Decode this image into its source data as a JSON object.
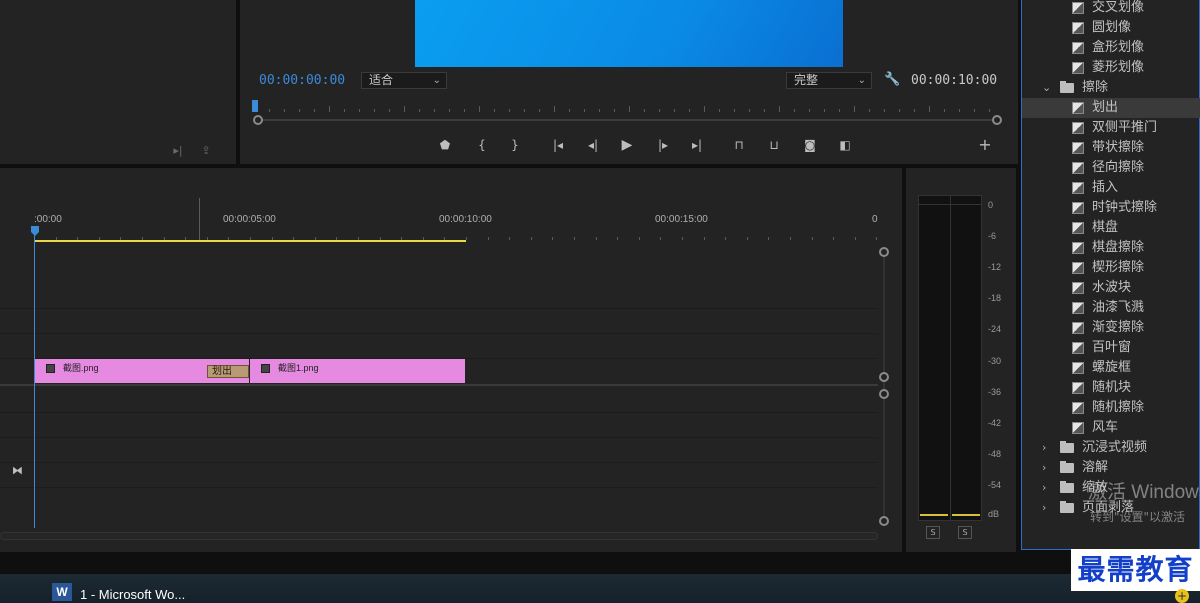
{
  "monitor": {
    "timecode_current": "00:00:00:00",
    "fit_select": "适合",
    "quality_select": "完整",
    "timecode_duration": "00:00:10:00",
    "add_button": "+"
  },
  "timeline": {
    "ruler_labels": [
      ":00:00",
      "00:00:05:00",
      "00:00:10:00",
      "00:00:15:00",
      "0"
    ],
    "clips": [
      {
        "name": "截图.png"
      },
      {
        "name": "截图1.png"
      }
    ],
    "transition_label": "划出"
  },
  "meter": {
    "db_labels": [
      "0",
      "-6",
      "-12",
      "-18",
      "-24",
      "-30",
      "-36",
      "-42",
      "-48",
      "-54",
      "dB"
    ],
    "solo_left": "S",
    "solo_right": "S"
  },
  "effects": {
    "items": [
      {
        "type": "effect",
        "label": "交叉划像"
      },
      {
        "type": "effect",
        "label": "圆划像"
      },
      {
        "type": "effect",
        "label": "盒形划像"
      },
      {
        "type": "effect",
        "label": "菱形划像"
      },
      {
        "type": "folder",
        "label": "擦除",
        "expanded": true
      },
      {
        "type": "effect",
        "label": "划出",
        "selected": true
      },
      {
        "type": "effect",
        "label": "双侧平推门"
      },
      {
        "type": "effect",
        "label": "带状擦除"
      },
      {
        "type": "effect",
        "label": "径向擦除"
      },
      {
        "type": "effect",
        "label": "插入"
      },
      {
        "type": "effect",
        "label": "时钟式擦除"
      },
      {
        "type": "effect",
        "label": "棋盘"
      },
      {
        "type": "effect",
        "label": "棋盘擦除"
      },
      {
        "type": "effect",
        "label": "楔形擦除"
      },
      {
        "type": "effect",
        "label": "水波块"
      },
      {
        "type": "effect",
        "label": "油漆飞溅"
      },
      {
        "type": "effect",
        "label": "渐变擦除"
      },
      {
        "type": "effect",
        "label": "百叶窗"
      },
      {
        "type": "effect",
        "label": "螺旋框"
      },
      {
        "type": "effect",
        "label": "随机块"
      },
      {
        "type": "effect",
        "label": "随机擦除"
      },
      {
        "type": "effect",
        "label": "风车"
      },
      {
        "type": "folder",
        "label": "沉浸式视频",
        "expanded": false
      },
      {
        "type": "folder",
        "label": "溶解",
        "expanded": false
      },
      {
        "type": "folder",
        "label": "缩放",
        "expanded": false
      },
      {
        "type": "folder",
        "label": "页面剥落",
        "expanded": false
      }
    ]
  },
  "watermark": {
    "line1": "激活 Windows",
    "line2": "转到\"设置\"以激活"
  },
  "taskbar": {
    "word_label": "1 - Microsoft Wo...",
    "word_icon_letter": "W"
  },
  "brand": {
    "text": "最需教育"
  },
  "colors": {
    "accent_blue": "#2d6bd1",
    "clip_pink": "#e58ae0",
    "work_area_yellow": "#e8d84a",
    "transition_tan": "#b89a74"
  }
}
